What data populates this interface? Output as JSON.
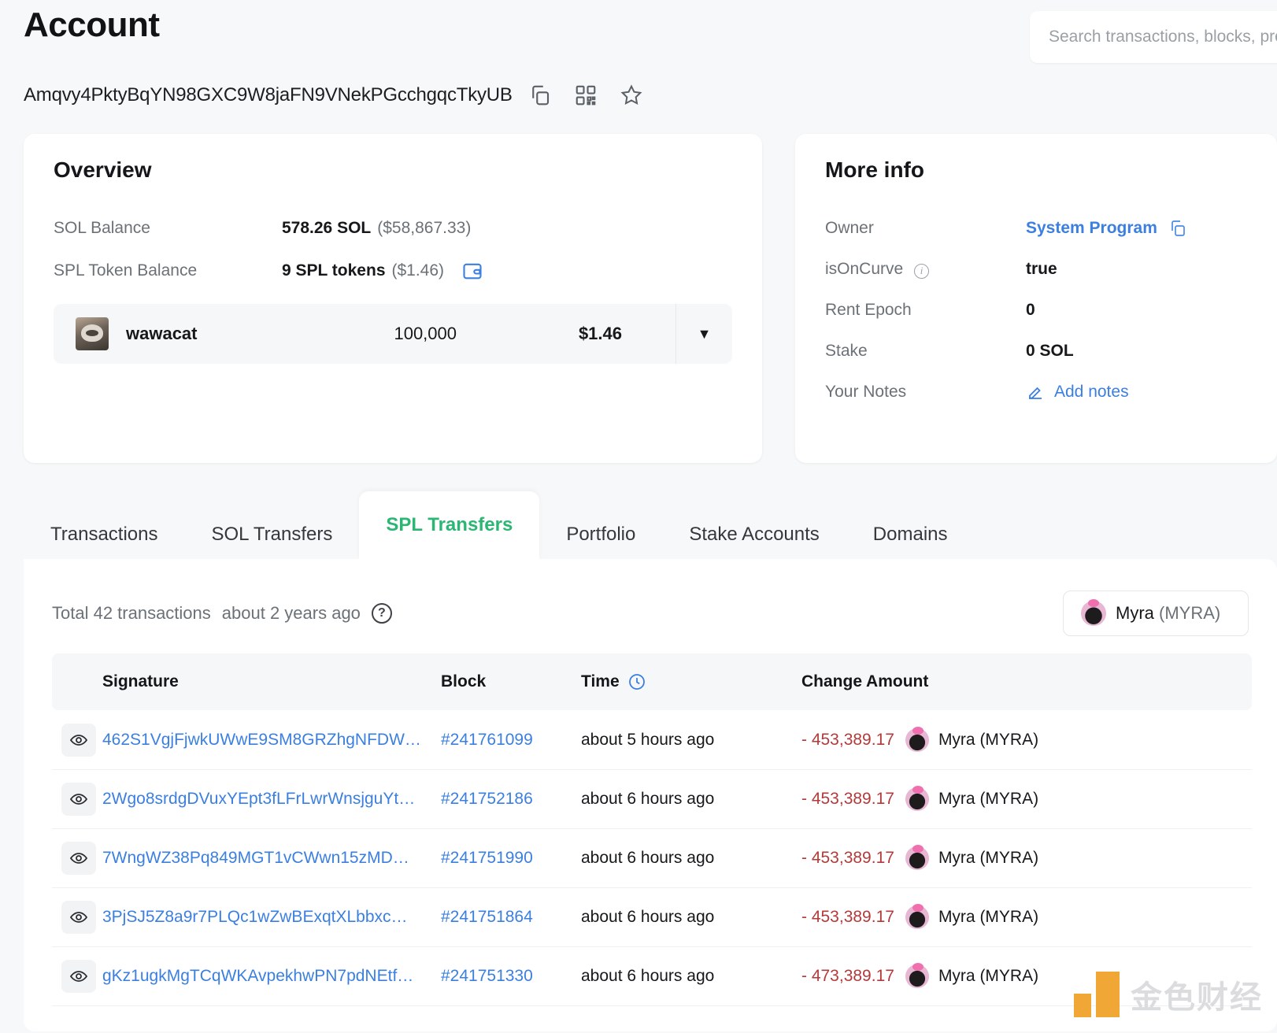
{
  "header": {
    "title": "Account",
    "address": "Amqvy4PktyBqYN98GXC9W8jaFN9VNekPGcchgqcTkyUB",
    "copy_icon": "copy-icon",
    "qr_icon": "qr-code-icon",
    "star_icon": "star-icon"
  },
  "search": {
    "placeholder": "Search transactions, blocks, programs and tokens",
    "value": ""
  },
  "overview": {
    "title": "Overview",
    "sol_balance_label": "SOL Balance",
    "sol_balance_value": "578.26 SOL",
    "sol_balance_usd": "($58,867.33)",
    "spl_balance_label": "SPL Token Balance",
    "spl_balance_value": "9 SPL tokens",
    "spl_balance_usd": "($1.46)",
    "wallet_icon": "wallet-icon",
    "token": {
      "name": "wawacat",
      "amount": "100,000",
      "value": "$1.46",
      "caret": "▼"
    }
  },
  "more_info": {
    "title": "More info",
    "owner_label": "Owner",
    "owner_value": "System Program",
    "is_on_curve_label": "isOnCurve",
    "is_on_curve_value": "true",
    "rent_epoch_label": "Rent Epoch",
    "rent_epoch_value": "0",
    "stake_label": "Stake",
    "stake_value": "0 SOL",
    "your_notes_label": "Your Notes",
    "add_notes_label": "Add notes"
  },
  "tabs": [
    {
      "label": "Transactions",
      "active": false
    },
    {
      "label": "SOL Transfers",
      "active": false
    },
    {
      "label": "SPL Transfers",
      "active": true
    },
    {
      "label": "Portfolio",
      "active": false
    },
    {
      "label": "Stake Accounts",
      "active": false
    },
    {
      "label": "Domains",
      "active": false
    }
  ],
  "panel": {
    "total_text": "Total 42 transactions",
    "age_text": "about 2 years ago",
    "help_icon": "question-mark-icon",
    "token_filter": {
      "name": "Myra",
      "symbol": "(MYRA)"
    },
    "columns": {
      "signature": "Signature",
      "block": "Block",
      "time": "Time",
      "change_amount": "Change Amount"
    },
    "time_icon": "clock-icon",
    "rows": [
      {
        "signature": "462S1VgjFjwkUWwE9SM8GRZhgNFDW…",
        "block": "#241761099",
        "time": "about 5 hours ago",
        "amount": "- 453,389.17",
        "token": "Myra (MYRA)"
      },
      {
        "signature": "2Wgo8srdgDVuxYEpt3fLFrLwrWnsjguYt…",
        "block": "#241752186",
        "time": "about 6 hours ago",
        "amount": "- 453,389.17",
        "token": "Myra (MYRA)"
      },
      {
        "signature": "7WngWZ38Pq849MGT1vCWwn15zMD…",
        "block": "#241751990",
        "time": "about 6 hours ago",
        "amount": "- 453,389.17",
        "token": "Myra (MYRA)"
      },
      {
        "signature": "3PjSJ5Z8a9r7PLQc1wZwBExqtXLbbxc…",
        "block": "#241751864",
        "time": "about 6 hours ago",
        "amount": "- 453,389.17",
        "token": "Myra (MYRA)"
      },
      {
        "signature": "gKz1ugkMgTCqWKAvpekhwPN7pdNEtf…",
        "block": "#241751330",
        "time": "about 6 hours ago",
        "amount": "- 473,389.17",
        "token": "Myra (MYRA)"
      }
    ]
  },
  "watermark": {
    "text": "金色财经"
  },
  "colors": {
    "accent_green": "#2bb673",
    "link_blue": "#3b7fe0",
    "negative_red": "#b33a3a",
    "page_bg": "#f7f8f9",
    "watermark_orange": "#f0a024"
  }
}
